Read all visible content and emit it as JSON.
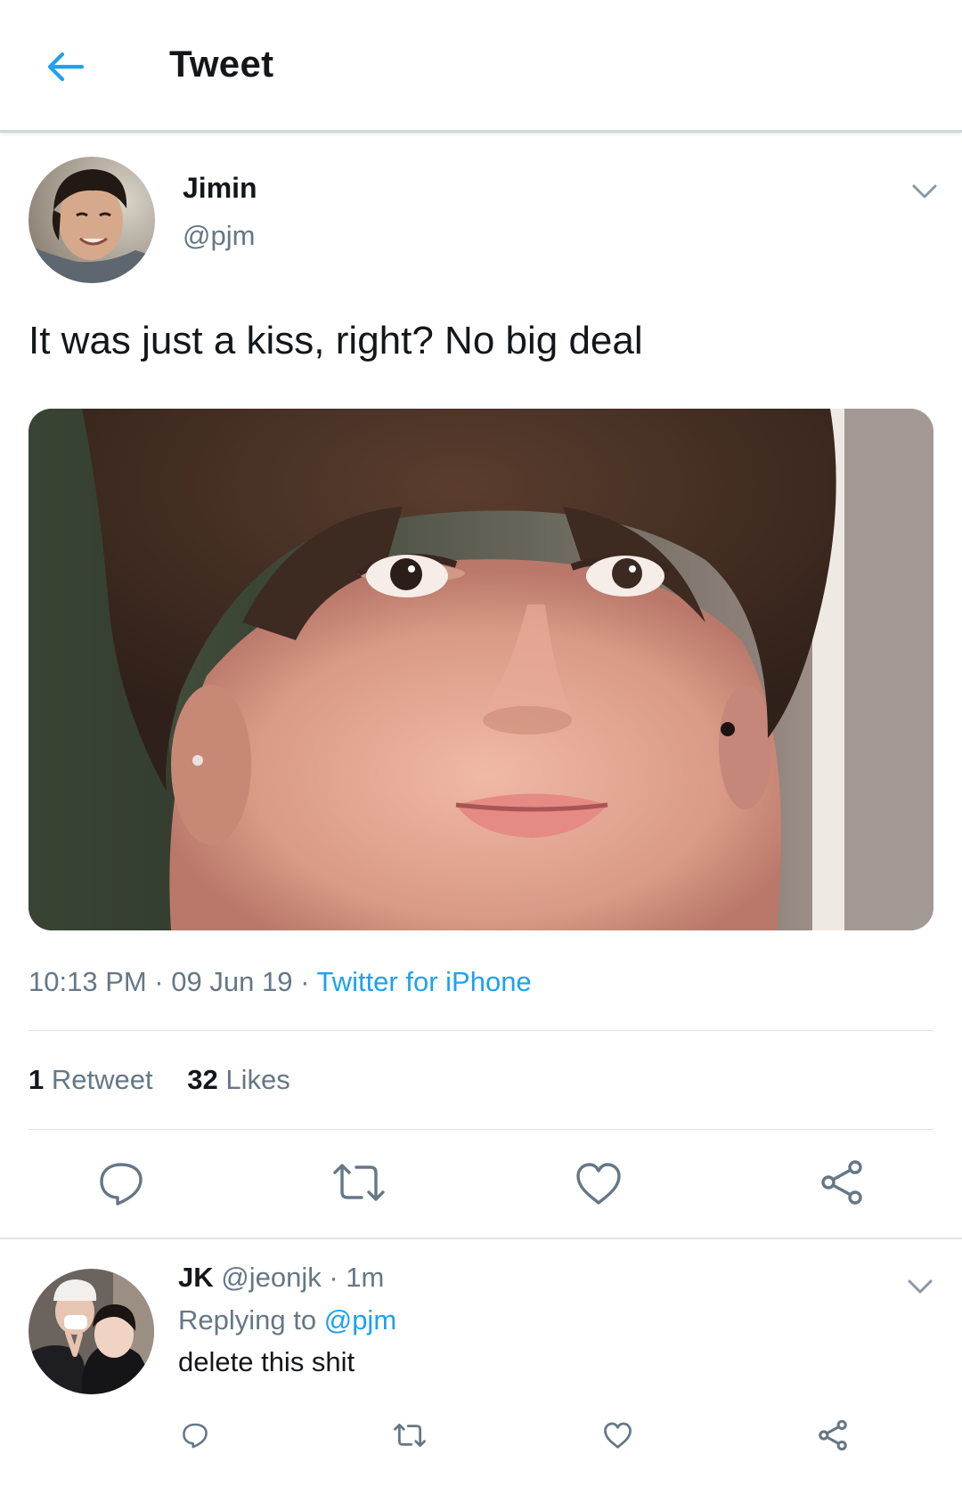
{
  "header": {
    "title": "Tweet",
    "back_icon": "arrow-left-icon",
    "accent": "#1da1f2"
  },
  "tweet": {
    "author_name": "Jimin",
    "author_handle": "@pjm",
    "text": "It was just a kiss, right? No big deal",
    "time": "10:13 PM",
    "date": "09 Jun 19",
    "source": "Twitter for iPhone",
    "retweet_count": "1",
    "retweet_label": "Retweet",
    "like_count": "32",
    "like_label": "Likes",
    "actions": [
      "reply-icon",
      "retweet-icon",
      "heart-icon",
      "share-icon"
    ]
  },
  "reply": {
    "author_name": "JK",
    "author_handle": "@jeonjk",
    "time": "1m",
    "replying_prefix": "Replying to",
    "replying_to": "@pjm",
    "text": "delete this shit",
    "actions": [
      "reply-icon",
      "retweet-icon",
      "heart-icon",
      "share-icon"
    ]
  },
  "colors": {
    "secondary_text": "#657786",
    "link": "#1da1f2",
    "divider": "#dde3e7"
  }
}
